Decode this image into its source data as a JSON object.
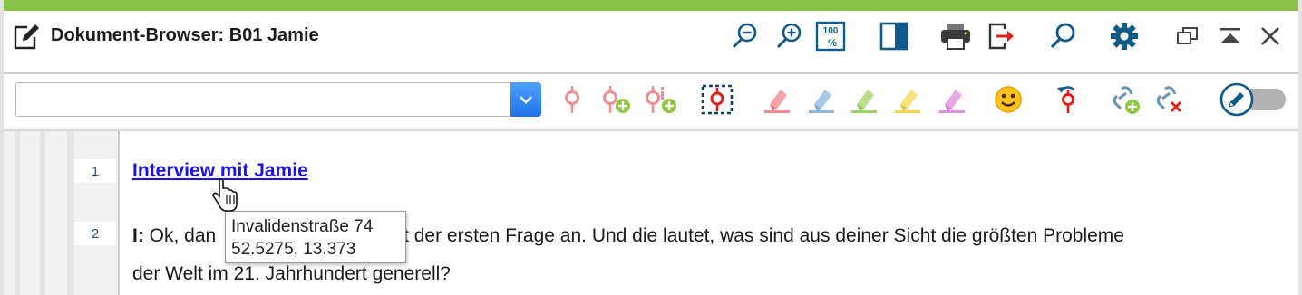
{
  "colors": {
    "accent": "#8bc34a",
    "icon_blue": "#0e5a8a",
    "link": "#1a12e8",
    "combo_blue": "#1f74ea"
  },
  "window": {
    "title": "Dokument-Browser: B01 Jamie",
    "title_icon": "edit-document-icon",
    "title_buttons": [
      "zoom-out-icon",
      "zoom-in-icon",
      "zoom-100-icon",
      "panel-toggle-icon",
      "print-icon",
      "export-icon",
      "search-icon",
      "settings-gear-icon",
      "restore-window-icon",
      "collapse-up-icon",
      "close-icon"
    ],
    "zoom_100_label": "100",
    "zoom_100_pct": "%"
  },
  "toolbar": {
    "search_value": "",
    "tools": [
      "code-icon",
      "code-add-icon",
      "code-info-add-icon",
      "code-selection-icon",
      "highlighter-red-icon",
      "highlighter-blue-icon",
      "highlighter-green-icon",
      "highlighter-yellow-icon",
      "highlighter-magenta-icon",
      "emoticon-icon",
      "recode-icon",
      "link-add-icon",
      "link-remove-icon"
    ],
    "edit_toggle": {
      "icon": "pencil-icon",
      "on": false
    }
  },
  "document": {
    "lines": [
      {
        "number": "1",
        "link_text": "Interview mit Jamie"
      },
      {
        "number": "2",
        "speaker": "I:",
        "line1_before": "Ok, dan",
        "line1_after": "mal mit der ersten Frage an. Und die lautet, was sind aus deiner Sicht die größten Probleme",
        "line2": "der Welt im 21. Jahrhundert generell?"
      }
    ],
    "tooltip": {
      "line1": "Invalidenstraße 74",
      "line2": "52.5275, 13.373"
    },
    "cursor_icon": "hand-pointer-icon"
  }
}
